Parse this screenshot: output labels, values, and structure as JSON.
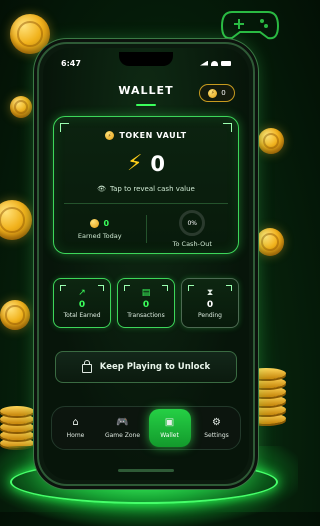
{
  "status": {
    "time": "6:47"
  },
  "header": {
    "title": "WALLET",
    "balance": "0"
  },
  "vault": {
    "label": "TOKEN VAULT",
    "amount": "0",
    "reveal_text": "Tap to reveal cash value",
    "earned_today_value": "0",
    "earned_today_label": "Earned Today",
    "cashout_percent": "0%",
    "cashout_label": "To Cash-Out"
  },
  "stats": [
    {
      "icon": "trending-up-icon",
      "value": "0",
      "label": "Total Earned"
    },
    {
      "icon": "receipt-icon",
      "value": "0",
      "label": "Transactions"
    },
    {
      "icon": "hourglass-icon",
      "value": "0",
      "label": "Pending"
    }
  ],
  "unlock": {
    "label": "Keep Playing to Unlock"
  },
  "nav": {
    "items": [
      {
        "label": "Home",
        "icon": "home-icon",
        "active": false
      },
      {
        "label": "Game Zone",
        "icon": "gamepad-icon",
        "active": false
      },
      {
        "label": "Wallet",
        "icon": "wallet-icon",
        "active": true
      },
      {
        "label": "Settings",
        "icon": "gear-icon",
        "active": false
      }
    ]
  },
  "colors": {
    "accent": "#3bff5c",
    "gold": "#ffcf1a",
    "background": "#06200b"
  }
}
